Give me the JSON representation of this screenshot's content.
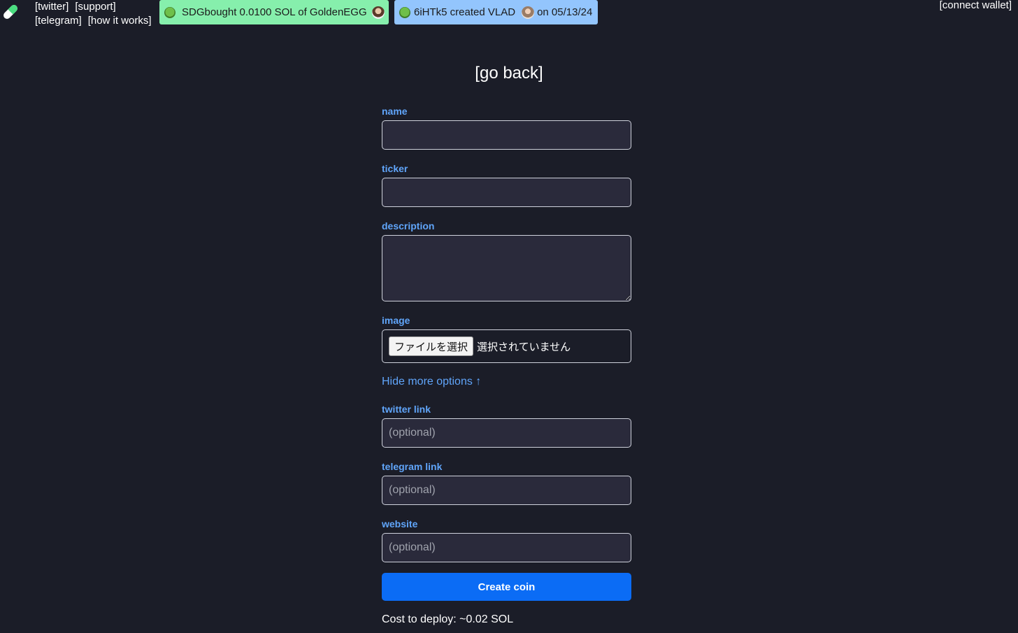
{
  "nav": {
    "links_row1": [
      "[twitter]",
      "[support]"
    ],
    "links_row2": [
      "[telegram]",
      "[how it works]"
    ],
    "connect_wallet": "[connect wallet]"
  },
  "activity": {
    "buy": {
      "user": "SDG",
      "text": "bought 0.0100 SOL of GoldenEGG",
      "color": "#86efac"
    },
    "create": {
      "text": "6iHTk5 created VLAD",
      "date_text": "on 05/13/24",
      "color": "#93c5fd"
    }
  },
  "page": {
    "go_back": "[go back]"
  },
  "form": {
    "name_label": "name",
    "name_value": "",
    "ticker_label": "ticker",
    "ticker_value": "",
    "description_label": "description",
    "description_value": "",
    "image_label": "image",
    "file_button": "ファイルを選択",
    "file_status": "選択されていません",
    "toggle_options": "Hide more options ↑",
    "twitter_label": "twitter link",
    "twitter_placeholder": "(optional)",
    "telegram_label": "telegram link",
    "telegram_placeholder": "(optional)",
    "website_label": "website",
    "website_placeholder": "(optional)",
    "submit": "Create coin",
    "cost": "Cost to deploy: ~0.02 SOL"
  },
  "colors": {
    "background": "#1b1d28",
    "label_blue": "#60a5fa",
    "primary_button": "#0b6cf5"
  }
}
